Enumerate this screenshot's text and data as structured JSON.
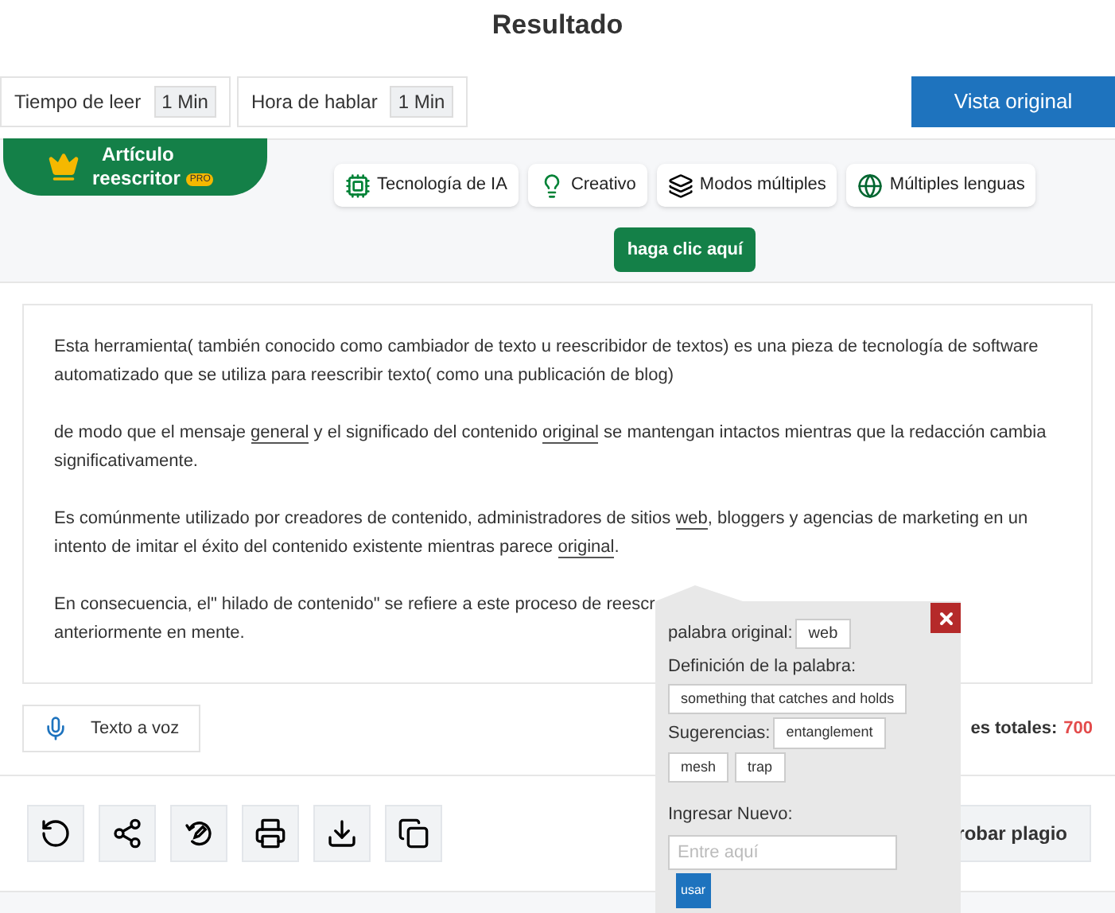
{
  "title": "Resultado",
  "stats": [
    {
      "label": "Tiempo de leer",
      "value": "1 Min"
    },
    {
      "label": "Hora de hablar",
      "value": "1 Min"
    }
  ],
  "original_button": "Vista original",
  "badge": {
    "line1": "Artículo",
    "line2": "reescritor",
    "tag": "PRO"
  },
  "features": [
    {
      "kind": "chip",
      "label": "Tecnología de IA"
    },
    {
      "kind": "bulb",
      "label": "Creativo"
    },
    {
      "kind": "modes",
      "label": "Modos múltiples"
    },
    {
      "kind": "globe",
      "label": "Múltiples lenguas"
    }
  ],
  "action_button": "haga clic aquí",
  "paragraphs": [
    [
      {
        "text": "Esta herramienta( también conocido como cambiador de texto u reescribidor de textos) es una pieza de tecnología de software automatizado que se utiliza para reescribir texto( como una publicación de blog)",
        "underlined": false
      }
    ],
    [
      {
        "text": "de modo que el mensaje ",
        "underlined": false
      },
      {
        "text": "general",
        "underlined": true
      },
      {
        "text": " y el significado del contenido ",
        "underlined": false
      },
      {
        "text": "original",
        "underlined": true
      },
      {
        "text": " se mantengan intactos mientras que la redacción cambia significativamente.",
        "underlined": false
      }
    ],
    [
      {
        "text": "Es comúnmente utilizado por creadores de contenido, administradores de sitios ",
        "underlined": false
      },
      {
        "text": "web",
        "underlined": true
      },
      {
        "text": ", bloggers y agencias de marketing en un intento de imitar el éxito del contenido existente mientras parece ",
        "underlined": false
      },
      {
        "text": "original",
        "underlined": true
      },
      {
        "text": ".",
        "underlined": false
      }
    ]
  ],
  "last_paragraph_lines": [
    "En consecuencia, el\" hilado de contenido\" se refiere a este proceso de reescr",
    "anteriormente en mente."
  ],
  "tts_button": "Texto a voz",
  "total_label": "es totales:",
  "total_value": "700",
  "tools": [
    {
      "kind": "undo"
    },
    {
      "kind": "share"
    },
    {
      "kind": "rewrite"
    },
    {
      "kind": "print"
    },
    {
      "kind": "download"
    },
    {
      "kind": "copy"
    }
  ],
  "plagiarism_button": "robar plagio",
  "popup": {
    "original_label": "palabra original:",
    "original_word": "web",
    "definition_label": "Definición de la palabra:",
    "definition": "something that catches and holds",
    "suggestions_label": "Sugerencias:",
    "suggestions": [
      "entanglement",
      "mesh",
      "trap"
    ],
    "new_label": "Ingresar Nuevo:",
    "placeholder": "Entre aquí",
    "use_button": "usar"
  }
}
